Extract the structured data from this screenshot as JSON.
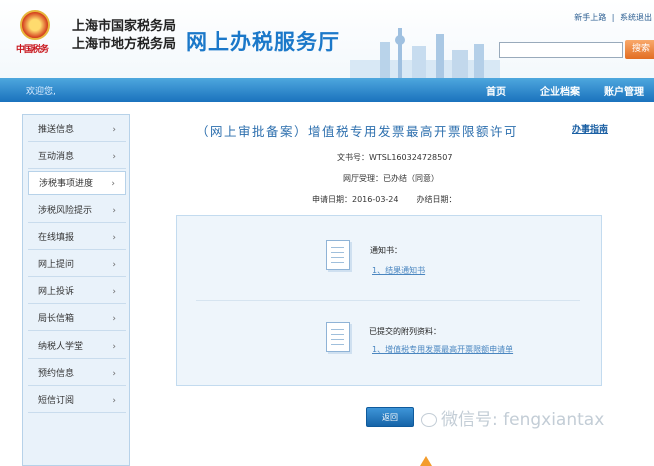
{
  "header": {
    "emblem_text": "中国税务",
    "bureau_line1": "上海市国家税务局",
    "bureau_line2": "上海市地方税务局",
    "portal_title": "网上办税服务厅",
    "top_links": [
      "新手上路",
      "系统退出"
    ],
    "search_placeholder": "",
    "search_button": "搜索"
  },
  "navbar": {
    "welcome": "欢迎您,",
    "items": [
      "首页",
      "企业档案",
      "账户管理"
    ]
  },
  "sidebar": {
    "items": [
      {
        "label": "推送信息",
        "active": false
      },
      {
        "label": "互动消息",
        "active": false
      },
      {
        "label": "涉税事项进度",
        "active": true
      },
      {
        "label": "涉税风险提示",
        "active": false
      },
      {
        "label": "在线填报",
        "active": false
      },
      {
        "label": "网上提问",
        "active": false
      },
      {
        "label": "网上投诉",
        "active": false
      },
      {
        "label": "局长信箱",
        "active": false
      },
      {
        "label": "纳税人学堂",
        "active": false
      },
      {
        "label": "预约信息",
        "active": false
      },
      {
        "label": "短信订阅",
        "active": false
      }
    ],
    "arrow": "›"
  },
  "main": {
    "title": "（网上审批备案）增值税专用发票最高开票限额许可",
    "guide_link": "办事指南",
    "doc_no": "文书号：WTSL160324728507",
    "dept_status": "网厅受理：已办结（同意）",
    "apply_date": "申请日期：2016-03-24",
    "finish_date": "办结日期：",
    "notice_label": "通知书：",
    "notice_link": "1、结果通知书",
    "attach_label": "已提交的附列资料：",
    "attach_link": "1、增值税专用发票最高开票限额申请单",
    "return_button": "返回"
  },
  "watermark": "微信号: fengxiantax",
  "colors": {
    "nav_blue": "#1a72bd",
    "title_blue": "#2d6fae",
    "search_orange": "#e26d22",
    "panel_bg": "#eef5fb"
  }
}
